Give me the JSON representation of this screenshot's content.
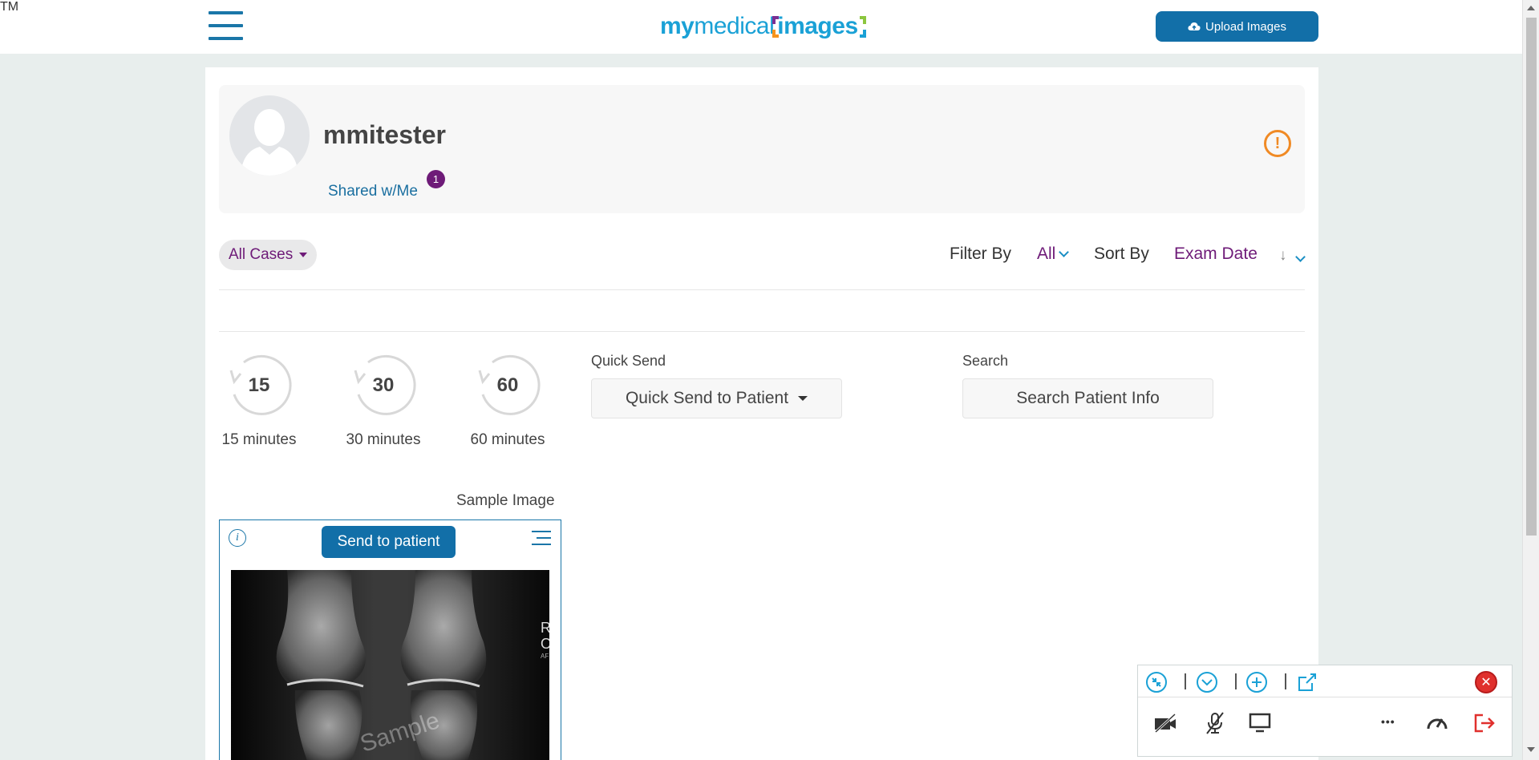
{
  "header": {
    "logo": {
      "my": "my",
      "medical": "medical",
      "images": "images",
      "tm": "TM"
    },
    "upload_label": "Upload Images"
  },
  "profile": {
    "username": "mmitester",
    "shared_label": "Shared w/Me",
    "shared_count": "1",
    "alert_glyph": "!"
  },
  "filters": {
    "cases_label": "All Cases",
    "filter_by_label": "Filter By",
    "filter_by_value": "All",
    "sort_by_label": "Sort By",
    "sort_by_value": "Exam Date",
    "sort_direction_glyph": "↓"
  },
  "timers": [
    {
      "value": "15",
      "label": "15 minutes"
    },
    {
      "value": "30",
      "label": "30 minutes"
    },
    {
      "value": "60",
      "label": "60 minutes"
    }
  ],
  "quick_send": {
    "label": "Quick Send",
    "button": "Quick Send to Patient"
  },
  "search": {
    "label": "Search",
    "placeholder": "Search Patient Info"
  },
  "sample": {
    "title": "Sample Image",
    "send_button": "Send to patient",
    "info_glyph": "i",
    "watermark": "Sample"
  },
  "panel": {
    "close_glyph": "✕",
    "more_glyph": "•••"
  },
  "colors": {
    "brand_blue": "#126fa8",
    "accent_purple": "#6e1b78",
    "alert_orange": "#f08a24",
    "close_red": "#e0302d"
  }
}
